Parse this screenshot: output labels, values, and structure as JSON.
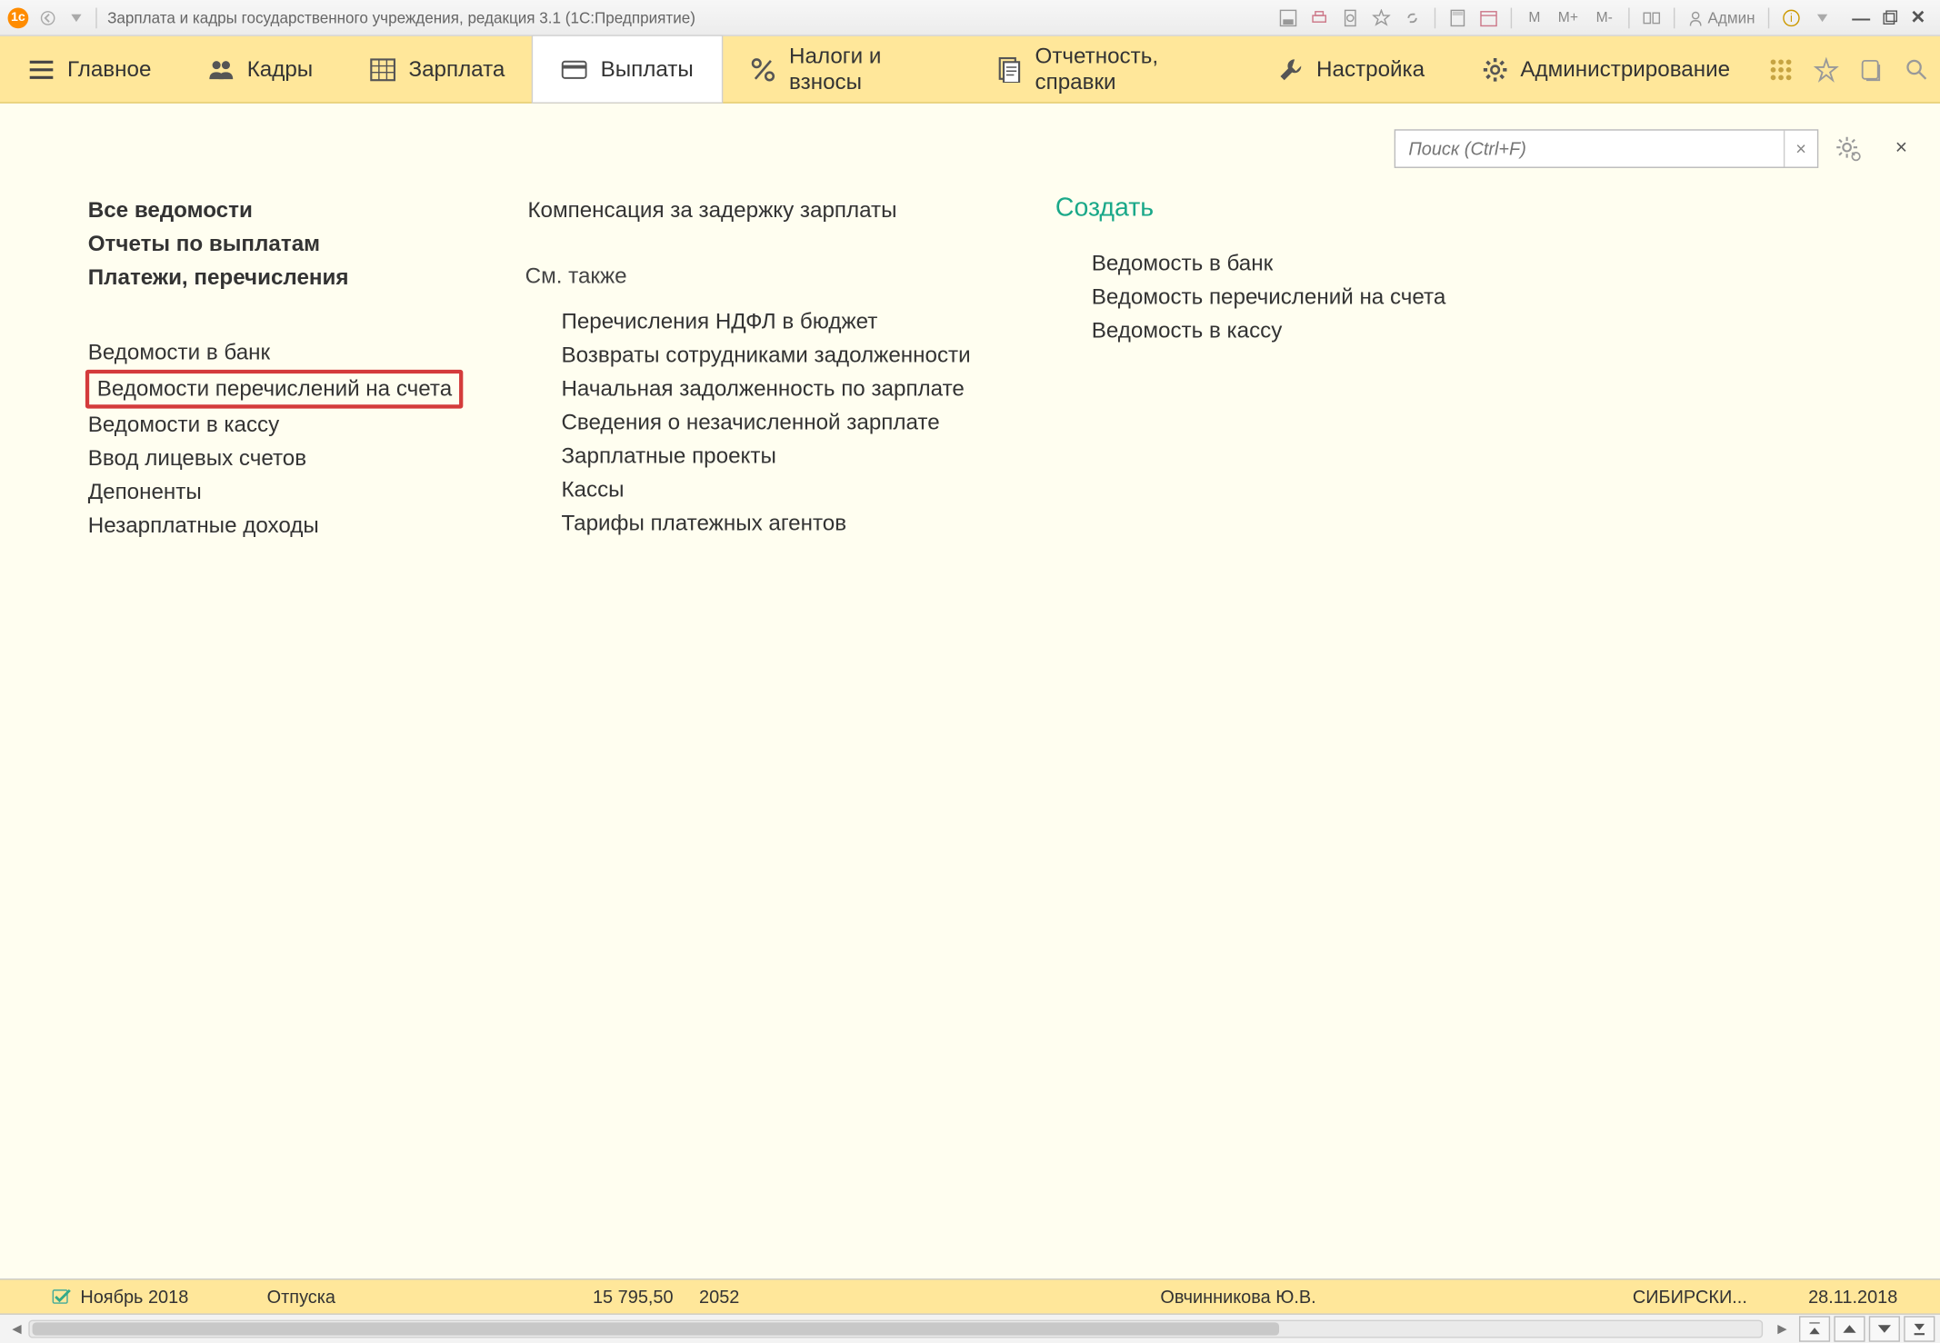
{
  "titlebar": {
    "title": "Зарплата и кадры государственного учреждения, редакция 3.1  (1С:Предприятие)",
    "user": "Админ",
    "letters": {
      "m1": "M",
      "m2": "M+",
      "m3": "M-"
    }
  },
  "menubar": {
    "items": [
      {
        "label": "Главное",
        "icon": "menu"
      },
      {
        "label": "Кадры",
        "icon": "people"
      },
      {
        "label": "Зарплата",
        "icon": "table"
      },
      {
        "label": "Выплаты",
        "icon": "card",
        "active": true
      },
      {
        "label": "Налоги и взносы",
        "icon": "percent"
      },
      {
        "label": "Отчетность, справки",
        "icon": "doc"
      },
      {
        "label": "Настройка",
        "icon": "wrench"
      },
      {
        "label": "Администрирование",
        "icon": "gear"
      }
    ]
  },
  "search": {
    "placeholder": "Поиск (Ctrl+F)"
  },
  "col1": {
    "top": [
      {
        "t": "Все ведомости",
        "bold": true
      },
      {
        "t": "Отчеты по выплатам",
        "bold": true
      },
      {
        "t": "Платежи, перечисления",
        "bold": true
      }
    ],
    "mid": [
      {
        "t": "Ведомости в банк"
      },
      {
        "t": "Ведомости перечислений на счета",
        "hl": true
      },
      {
        "t": "Ведомости в кассу"
      },
      {
        "t": "Ввод лицевых счетов"
      },
      {
        "t": "Депоненты"
      },
      {
        "t": "Незарплатные доходы"
      }
    ]
  },
  "col2": {
    "top": [
      {
        "t": "Компенсация за задержку зарплаты"
      }
    ],
    "see_also_label": "См. также",
    "see_also": [
      {
        "t": "Перечисления НДФЛ в бюджет"
      },
      {
        "t": "Возвраты сотрудниками задолженности"
      },
      {
        "t": "Начальная задолженность по зарплате"
      },
      {
        "t": "Сведения о незачисленной зарплате"
      },
      {
        "t": "Зарплатные проекты"
      },
      {
        "t": "Кассы"
      },
      {
        "t": "Тарифы платежных агентов"
      }
    ]
  },
  "col3": {
    "header": "Создать",
    "items": [
      {
        "t": "Ведомость в банк"
      },
      {
        "t": "Ведомость перечислений на счета"
      },
      {
        "t": "Ведомость в кассу"
      }
    ]
  },
  "gridrow": {
    "c1": "Ноябрь 2018",
    "c2": "Отпуска",
    "c3": "15 795,50",
    "c4": "2052",
    "c5": "Овчинникова Ю.В.",
    "c6": "СИБИРСКИ...",
    "c7": "28.11.2018"
  }
}
